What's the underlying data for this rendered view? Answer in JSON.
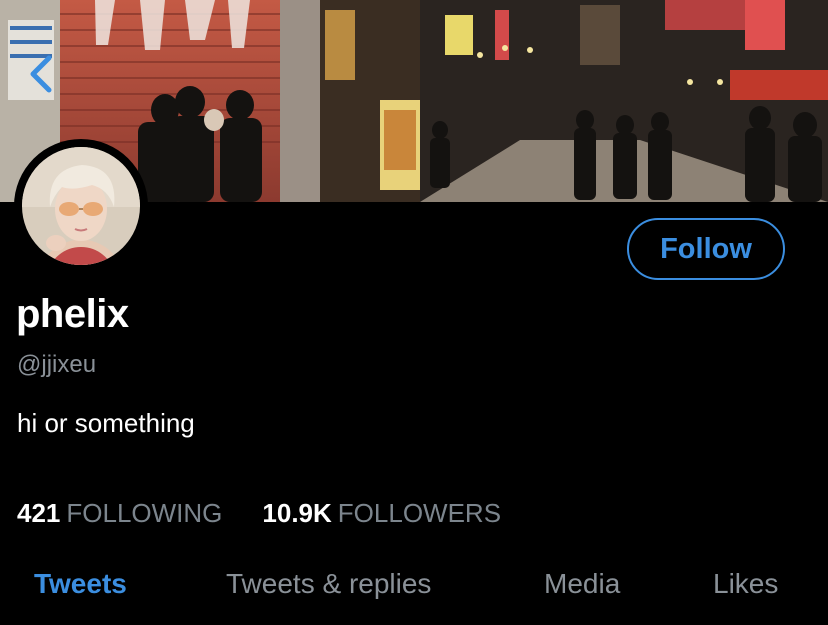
{
  "colors": {
    "background": "#000000",
    "accent": "#3b8ee0",
    "secondary_text": "#8a9198"
  },
  "header": {
    "back_icon": "chevron-left-icon"
  },
  "profile": {
    "display_name": "phelix",
    "handle": "@jjixeu",
    "bio": "hi or something",
    "follow_label": "Follow"
  },
  "stats": {
    "following_count": "421",
    "following_label": "FOLLOWING",
    "followers_count": "10.9K",
    "followers_label": "FOLLOWERS"
  },
  "tabs": [
    {
      "label": "Tweets",
      "active": true
    },
    {
      "label": "Tweets & replies",
      "active": false
    },
    {
      "label": "Media",
      "active": false
    },
    {
      "label": "Likes",
      "active": false
    }
  ]
}
